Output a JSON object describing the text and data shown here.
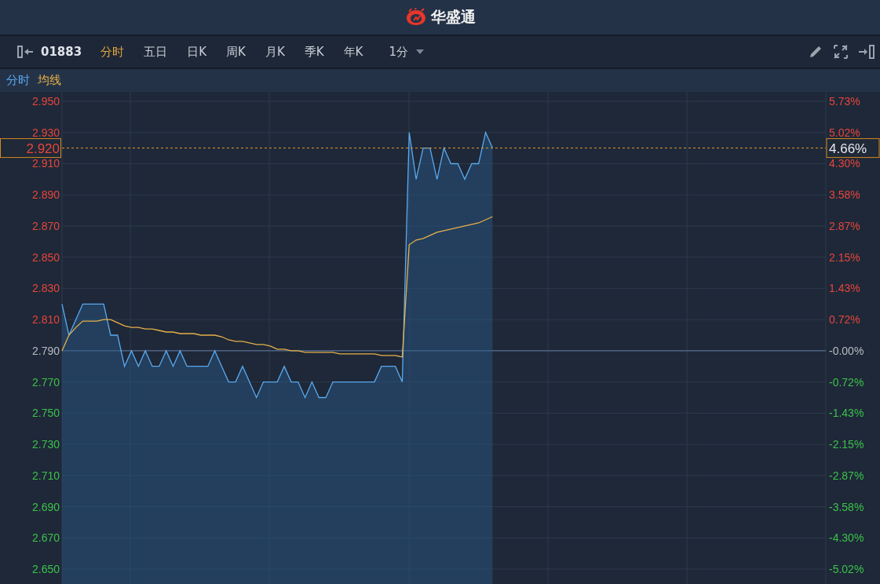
{
  "title_bar": {
    "title": "华盛通"
  },
  "toolbar": {
    "code": "01883",
    "tabs": [
      {
        "label": "分时",
        "selected": true
      },
      {
        "label": "五日",
        "selected": false
      },
      {
        "label": "日K",
        "selected": false
      },
      {
        "label": "周K",
        "selected": false
      },
      {
        "label": "月K",
        "selected": false
      },
      {
        "label": "季K",
        "selected": false
      },
      {
        "label": "年K",
        "selected": false
      }
    ],
    "interval": "1分"
  },
  "right_axis": {
    "labels": [
      "5.73%",
      "5.02%",
      "4.30%",
      "3.58%",
      "2.87%",
      "2.15%",
      "1.43%",
      "0.72%",
      "-0.00%",
      "-0.72%",
      "-1.43%",
      "-2.15%",
      "-2.87%",
      "-3.58%",
      "-4.30%",
      "-5.02%"
    ],
    "crosshair_label": "4.66%"
  },
  "chart_data": {
    "type": "area",
    "grid": true,
    "ylim": [
      2.65,
      2.95
    ],
    "categories": [
      null,
      null,
      null,
      null,
      null,
      null,
      null,
      null,
      null,
      null,
      null,
      null,
      null,
      null,
      null,
      null,
      null,
      null,
      null,
      null,
      null,
      null,
      null,
      null,
      null,
      null,
      null,
      null,
      null,
      null,
      null,
      null,
      null,
      null,
      null,
      null,
      null,
      null,
      null,
      null,
      null,
      null,
      null,
      null,
      null,
      null,
      null,
      null,
      null,
      null,
      null,
      null,
      null,
      null,
      null,
      null,
      null,
      null,
      null,
      null,
      null,
      null,
      null,
      null,
      null,
      null,
      null,
      null,
      null,
      null,
      null,
      null,
      null,
      null,
      null,
      null,
      null,
      null,
      null,
      null,
      null,
      null,
      null,
      null,
      null,
      null,
      null,
      null,
      null,
      null,
      null,
      null,
      null,
      null,
      null,
      null,
      null,
      null,
      null,
      null,
      null,
      null,
      null,
      null,
      null,
      null,
      null,
      null,
      null,
      null,
      null
    ],
    "yticks": [
      {
        "value": 2.95,
        "label": "2.950"
      },
      {
        "value": 2.93,
        "label": "2.930"
      },
      {
        "value": 2.91,
        "label": "2.910"
      },
      {
        "value": 2.89,
        "label": "2.890"
      },
      {
        "value": 2.87,
        "label": "2.870"
      },
      {
        "value": 2.85,
        "label": "2.850"
      },
      {
        "value": 2.83,
        "label": "2.830"
      },
      {
        "value": 2.81,
        "label": "2.810"
      },
      {
        "value": 2.79,
        "label": "2.790"
      },
      {
        "value": 2.77,
        "label": "2.770"
      },
      {
        "value": 2.75,
        "label": "2.750"
      },
      {
        "value": 2.73,
        "label": "2.730"
      },
      {
        "value": 2.71,
        "label": "2.710"
      },
      {
        "value": 2.69,
        "label": "2.690"
      },
      {
        "value": 2.67,
        "label": "2.670"
      },
      {
        "value": 2.65,
        "label": "2.650"
      }
    ],
    "series": [
      {
        "name": "分时",
        "color": "#5aa9f0",
        "values": [
          2.82,
          2.8,
          2.81,
          2.82,
          2.82,
          2.82,
          2.82,
          2.8,
          2.8,
          2.78,
          2.79,
          2.78,
          2.79,
          2.78,
          2.78,
          2.79,
          2.78,
          2.79,
          2.78,
          2.78,
          2.78,
          2.78,
          2.79,
          2.78,
          2.77,
          2.77,
          2.78,
          2.77,
          2.76,
          2.77,
          2.77,
          2.77,
          2.78,
          2.77,
          2.77,
          2.76,
          2.77,
          2.76,
          2.76,
          2.77,
          2.77,
          2.77,
          2.77,
          2.77,
          2.77,
          2.77,
          2.78,
          2.78,
          2.78,
          2.77,
          2.93,
          2.9,
          2.92,
          2.92,
          2.9,
          2.92,
          2.91,
          2.91,
          2.9,
          2.91,
          2.91,
          2.93,
          2.92,
          null,
          null,
          null,
          null,
          null,
          null,
          null,
          null,
          null,
          null,
          null,
          null,
          null,
          null,
          null,
          null,
          null,
          null,
          null,
          null,
          null,
          null,
          null,
          null,
          null,
          null,
          null,
          null,
          null,
          null,
          null,
          null,
          null,
          null,
          null,
          null,
          null,
          null,
          null,
          null,
          null,
          null,
          null,
          null,
          null,
          null,
          null,
          null
        ]
      },
      {
        "name": "均线",
        "color": "#e8b04a",
        "type": "line",
        "values": [
          2.79,
          2.8,
          2.805,
          2.809,
          2.809,
          2.809,
          2.81,
          2.81,
          2.808,
          2.806,
          2.805,
          2.805,
          2.804,
          2.804,
          2.803,
          2.802,
          2.802,
          2.801,
          2.801,
          2.801,
          2.8,
          2.8,
          2.8,
          2.799,
          2.797,
          2.796,
          2.796,
          2.795,
          2.794,
          2.794,
          2.793,
          2.791,
          2.791,
          2.79,
          2.79,
          2.789,
          2.789,
          2.789,
          2.789,
          2.789,
          2.788,
          2.788,
          2.788,
          2.788,
          2.788,
          2.788,
          2.787,
          2.787,
          2.787,
          2.786,
          2.858,
          2.861,
          2.862,
          2.864,
          2.866,
          2.867,
          2.868,
          2.869,
          2.87,
          2.871,
          2.872,
          2.874,
          2.876,
          null,
          null,
          null,
          null,
          null,
          null,
          null,
          null,
          null,
          null,
          null,
          null,
          null,
          null,
          null,
          null,
          null,
          null,
          null,
          null,
          null,
          null,
          null,
          null,
          null,
          null,
          null,
          null,
          null,
          null,
          null,
          null,
          null,
          null,
          null,
          null,
          null,
          null,
          null,
          null,
          null,
          null,
          null,
          null,
          null,
          null,
          null,
          null
        ]
      }
    ],
    "ref_lines": [
      {
        "axis": "y",
        "value": 2.79
      },
      {
        "axis": "y",
        "value": 2.92,
        "label": "2.920"
      }
    ]
  }
}
